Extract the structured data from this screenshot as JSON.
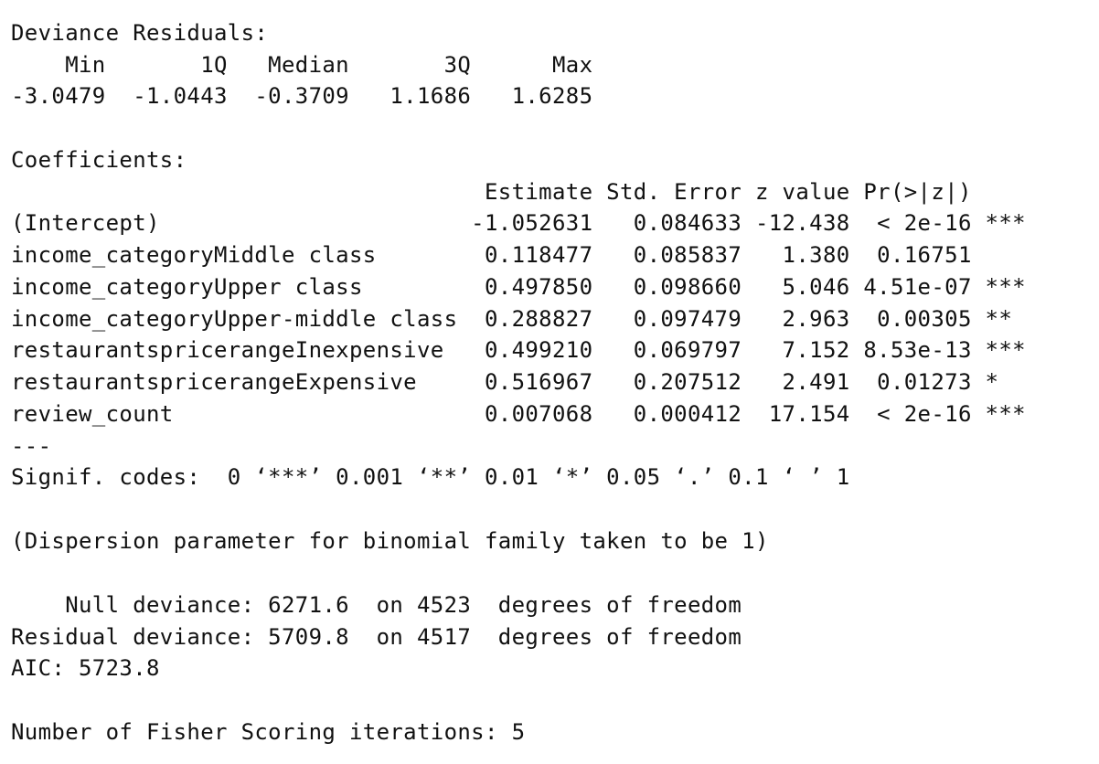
{
  "console_output": {
    "deviance_residuals": {
      "heading": "Deviance Residuals:",
      "labels_line": "    Min       1Q   Median       3Q      Max  ",
      "values_line": "-3.0479  -1.0443  -0.3709   1.1686   1.6285  "
    },
    "coefficients": {
      "heading": "Coefficients:",
      "header_line": "                                   Estimate Std. Error z value Pr(>|z|)    ",
      "rows": [
        "(Intercept)                       -1.052631   0.084633 -12.438  < 2e-16 ***",
        "income_categoryMiddle class        0.118477   0.085837   1.380  0.16751    ",
        "income_categoryUpper class         0.497850   0.098660   5.046 4.51e-07 ***",
        "income_categoryUpper-middle class  0.288827   0.097479   2.963  0.00305 ** ",
        "restaurantspricerangeInexpensive   0.499210   0.069797   7.152 8.53e-13 ***",
        "restaurantspricerangeExpensive     0.516967   0.207512   2.491  0.01273 *  ",
        "review_count                       0.007068   0.000412  17.154  < 2e-16 ***"
      ],
      "separator": "---",
      "signif_codes": "Signif. codes:  0 ‘***’ 0.001 ‘**’ 0.01 ‘*’ 0.05 ‘.’ 0.1 ‘ ’ 1"
    },
    "dispersion_note": "(Dispersion parameter for binomial family taken to be 1)",
    "null_deviance": "    Null deviance: 6271.6  on 4523  degrees of freedom",
    "residual_deviance": "Residual deviance: 5709.8  on 4517  degrees of freedom",
    "aic": "AIC: 5723.8",
    "fisher_iterations": "Number of Fisher Scoring iterations: 5"
  }
}
